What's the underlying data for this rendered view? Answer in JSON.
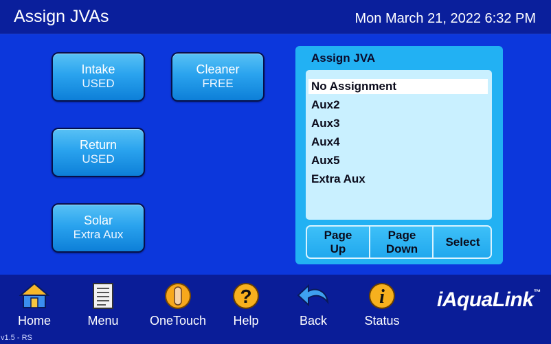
{
  "header": {
    "title": "Assign JVAs",
    "datetime": "Mon March 21, 2022 6:32 PM"
  },
  "valves": [
    {
      "name": "Intake",
      "state": "USED"
    },
    {
      "name": "Cleaner",
      "state": "FREE"
    },
    {
      "name": "Return",
      "state": "USED"
    },
    {
      "name": "Solar",
      "state": "Extra Aux"
    }
  ],
  "panel": {
    "title": "Assign JVA",
    "items": [
      "No Assignment",
      "Aux2",
      "Aux3",
      "Aux4",
      "Aux5",
      "Extra Aux"
    ],
    "selected": "No Assignment",
    "page_up": {
      "line1": "Page",
      "line2": "Up"
    },
    "page_down": {
      "line1": "Page",
      "line2": "Down"
    },
    "select": "Select"
  },
  "nav": {
    "home": "Home",
    "menu": "Menu",
    "onetouch": "OneTouch",
    "help": "Help",
    "back": "Back",
    "status": "Status"
  },
  "brand": {
    "name": "iAquaLink",
    "trademark": "™"
  },
  "version": "v1.5 - RS",
  "colors": {
    "background": "#0c37dc",
    "header": "#0a1f9c",
    "button": "#2aa3ee",
    "panel": "#22b1f3",
    "listbox": "#c9f0ff"
  }
}
